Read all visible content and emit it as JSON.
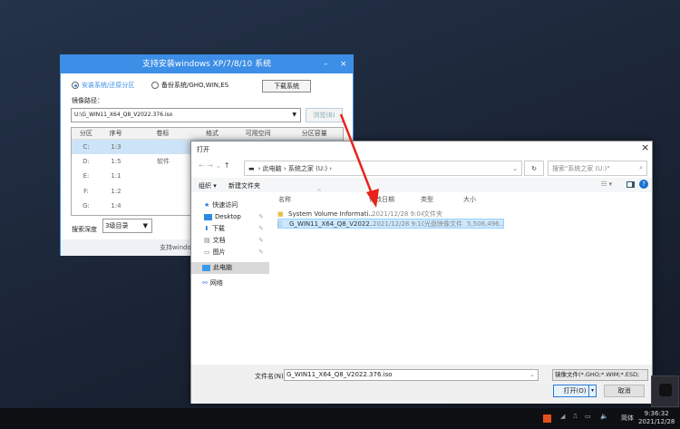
{
  "installer": {
    "title": "支持安装windows XP/7/8/10 系统",
    "minimize": "–",
    "close": "×",
    "radio_install": "安装系统/还原分区",
    "radio_backup": "备份系统/GHO,WIN,ES",
    "download_button": "下载系统",
    "image_path_label": "镜像路径：",
    "image_path_value": "U:\\G_WIN11_X64_Q8_V2022.376.iso",
    "browse_button": "浏览(B)",
    "columns": [
      "分区",
      "序号",
      "卷标",
      "格式",
      "可用空间",
      "分区容量"
    ],
    "rows": [
      {
        "part": "C:",
        "seq": "1:3",
        "label": ""
      },
      {
        "part": "D:",
        "seq": "1:5",
        "label": "软件"
      },
      {
        "part": "E:",
        "seq": "1:1",
        "label": ""
      },
      {
        "part": "F:",
        "seq": "1:2",
        "label": ""
      },
      {
        "part": "G:",
        "seq": "1:4",
        "label": ""
      }
    ],
    "search_depth_label": "搜索深度",
    "search_depth_value": "3级目录",
    "footer": "支持windows原版镜像，GHOST"
  },
  "dialog": {
    "title": "打开",
    "close": "×",
    "breadcrumb": [
      "此电脑",
      "系统之家 (U:)"
    ],
    "search_placeholder": "搜索\"系统之家 (U:)\"",
    "organize": "组织 ▾",
    "new_folder": "新建文件夹",
    "nav": [
      {
        "label": "快速访问",
        "icon": "star-icon"
      },
      {
        "label": "Desktop",
        "icon": "desktop-icon"
      },
      {
        "label": "下载",
        "icon": "download-icon"
      },
      {
        "label": "文档",
        "icon": "document-icon"
      },
      {
        "label": "图片",
        "icon": "picture-icon"
      },
      {
        "label": "此电脑",
        "icon": "computer-icon"
      },
      {
        "label": "网络",
        "icon": "network-icon"
      }
    ],
    "columns": [
      "名称",
      "修改日期",
      "类型",
      "大小"
    ],
    "files": [
      {
        "name": "System Volume Informati...",
        "date": "2021/12/28 9:04",
        "type": "文件夹",
        "size": ""
      },
      {
        "name": "G_WIN11_X64_Q8_V2022....",
        "date": "2021/12/28 9:10",
        "type": "光盘映像文件",
        "size": "5,506,496..."
      }
    ],
    "filename_label": "文件名(N):",
    "filename_value": "G_WIN11_X64_Q8_V2022.376.iso",
    "filetype": "镜像文件(*.GHO;*.WIM;*.ESD;",
    "open_button": "打开(O)",
    "cancel_button": "取消"
  },
  "taskbar": {
    "ime": "简体",
    "time": "9:36:32",
    "date": "2021/12/28"
  },
  "colors": {
    "accent": "#3c8ee6",
    "arrow": "#e8231b",
    "selection": "#cce8ff"
  }
}
